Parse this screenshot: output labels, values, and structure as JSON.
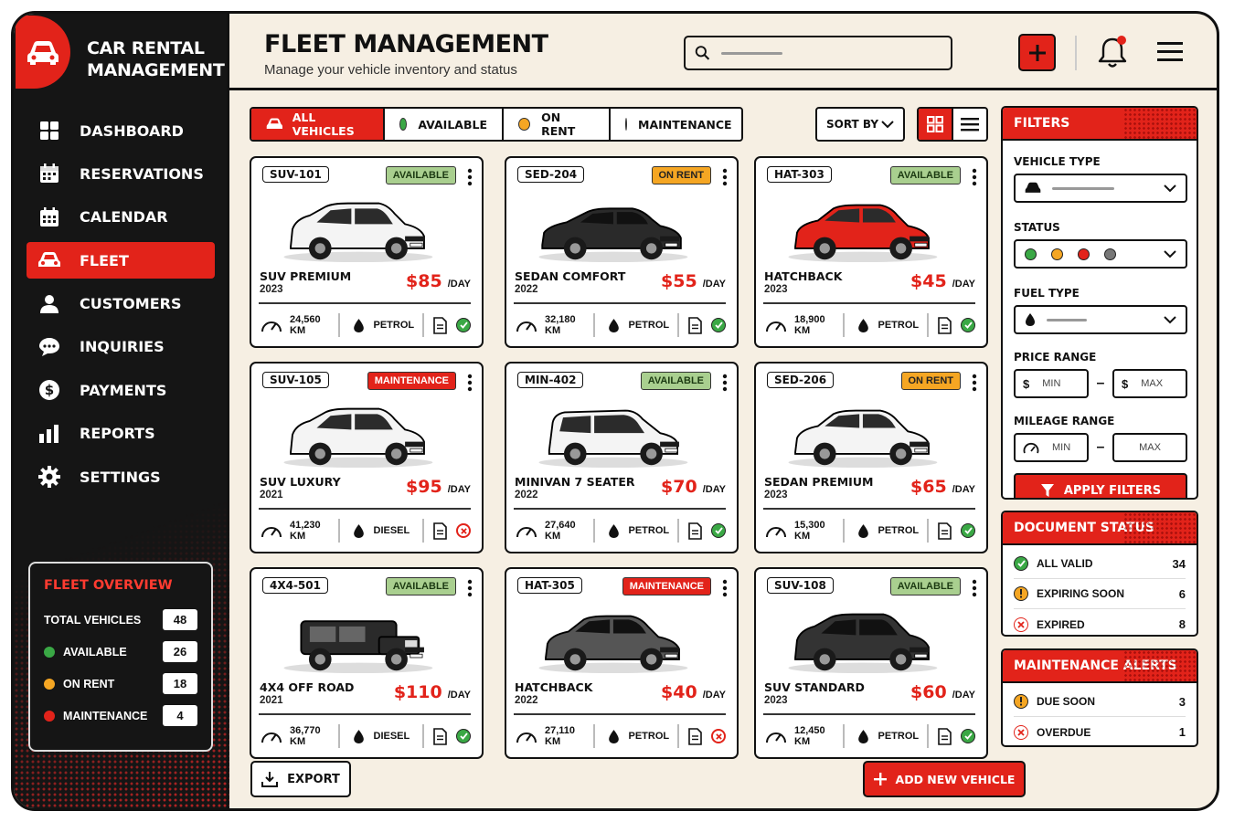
{
  "app": {
    "title_line1": "CAR RENTAL",
    "title_line2": "MANAGEMENT"
  },
  "nav": {
    "items": [
      {
        "label": "DASHBOARD",
        "icon": "dashboard-grid-icon"
      },
      {
        "label": "RESERVATIONS",
        "icon": "calendar-icon"
      },
      {
        "label": "CALENDAR",
        "icon": "calendar-icon"
      },
      {
        "label": "FLEET",
        "icon": "car-icon",
        "active": true
      },
      {
        "label": "CUSTOMERS",
        "icon": "user-icon"
      },
      {
        "label": "INQUIRIES",
        "icon": "chat-bubble-icon"
      },
      {
        "label": "PAYMENTS",
        "icon": "dollar-icon"
      },
      {
        "label": "REPORTS",
        "icon": "bar-chart-icon"
      },
      {
        "label": "SETTINGS",
        "icon": "gear-icon"
      }
    ]
  },
  "overview": {
    "title": "FLEET OVERVIEW",
    "rows": [
      {
        "label": "TOTAL VEHICLES",
        "value": "48",
        "color": ""
      },
      {
        "label": "AVAILABLE",
        "value": "26",
        "color": "#3aa845"
      },
      {
        "label": "ON RENT",
        "value": "18",
        "color": "#f5a623"
      },
      {
        "label": "MAINTENANCE",
        "value": "4",
        "color": "#e2231a"
      }
    ]
  },
  "header": {
    "title": "FLEET MANAGEMENT",
    "subtitle": "Manage your vehicle inventory and status"
  },
  "search": {
    "placeholder": ""
  },
  "tabs": {
    "all": "ALL VEHICLES",
    "available": "AVAILABLE",
    "onrent": "ON RENT",
    "maintenance": "MAINTENANCE"
  },
  "sort": {
    "label": "SORT BY"
  },
  "colors": {
    "accent": "#e2231a",
    "available": "#3aa845",
    "onrent": "#f5a623",
    "maintenance": "#e2231a",
    "grey": "#777777"
  },
  "vehicles": [
    {
      "code": "SUV-101",
      "status": "AVAILABLE",
      "name": "SUV PREMIUM",
      "year": "2023",
      "price": "$85",
      "unit": "/DAY",
      "km": "24,560",
      "km_unit": "KM",
      "fuel": "PETROL",
      "doc_ok": true,
      "body_color": "#f4f4f4",
      "style": "suv"
    },
    {
      "code": "SED-204",
      "status": "ON RENT",
      "name": "SEDAN COMFORT",
      "year": "2022",
      "price": "$55",
      "unit": "/DAY",
      "km": "32,180",
      "km_unit": "KM",
      "fuel": "PETROL",
      "doc_ok": true,
      "body_color": "#2a2a2a",
      "style": "sedan"
    },
    {
      "code": "HAT-303",
      "status": "AVAILABLE",
      "name": "HATCHBACK",
      "year": "2023",
      "price": "$45",
      "unit": "/DAY",
      "km": "18,900",
      "km_unit": "KM",
      "fuel": "PETROL",
      "doc_ok": true,
      "body_color": "#e2231a",
      "style": "hatch"
    },
    {
      "code": "SUV-105",
      "status": "MAINTENANCE",
      "name": "SUV LUXURY",
      "year": "2021",
      "price": "$95",
      "unit": "/DAY",
      "km": "41,230",
      "km_unit": "KM",
      "fuel": "DIESEL",
      "doc_ok": false,
      "body_color": "#f4f4f4",
      "style": "suv"
    },
    {
      "code": "MIN-402",
      "status": "AVAILABLE",
      "name": "MINIVAN 7 SEATER",
      "year": "2022",
      "price": "$70",
      "unit": "/DAY",
      "km": "27,640",
      "km_unit": "KM",
      "fuel": "PETROL",
      "doc_ok": true,
      "body_color": "#f4f4f4",
      "style": "van"
    },
    {
      "code": "SED-206",
      "status": "ON RENT",
      "name": "SEDAN PREMIUM",
      "year": "2023",
      "price": "$65",
      "unit": "/DAY",
      "km": "15,300",
      "km_unit": "KM",
      "fuel": "PETROL",
      "doc_ok": true,
      "body_color": "#f4f4f4",
      "style": "hatch"
    },
    {
      "code": "4X4-501",
      "status": "AVAILABLE",
      "name": "4X4 OFF ROAD",
      "year": "2021",
      "price": "$110",
      "unit": "/DAY",
      "km": "36,770",
      "km_unit": "KM",
      "fuel": "DIESEL",
      "doc_ok": true,
      "body_color": "#2a2a2a",
      "style": "jeep"
    },
    {
      "code": "HAT-305",
      "status": "MAINTENANCE",
      "name": "HATCHBACK",
      "year": "2022",
      "price": "$40",
      "unit": "/DAY",
      "km": "27,110",
      "km_unit": "KM",
      "fuel": "PETROL",
      "doc_ok": false,
      "body_color": "#555555",
      "style": "hatch"
    },
    {
      "code": "SUV-108",
      "status": "AVAILABLE",
      "name": "SUV STANDARD",
      "year": "2023",
      "price": "$60",
      "unit": "/DAY",
      "km": "12,450",
      "km_unit": "KM",
      "fuel": "PETROL",
      "doc_ok": true,
      "body_color": "#333333",
      "style": "suv"
    }
  ],
  "buttons": {
    "export": "EXPORT",
    "add_new": "ADD NEW VEHICLE",
    "apply": "APPLY FILTERS"
  },
  "filters": {
    "title": "FILTERS",
    "vehicle_type": "VEHICLE TYPE",
    "status": "STATUS",
    "fuel_type": "FUEL TYPE",
    "price_range": "PRICE RANGE",
    "mileage_range": "MILEAGE RANGE",
    "min": "MIN",
    "max": "MAX",
    "dash": "–",
    "dollar": "$"
  },
  "documents": {
    "title": "DOCUMENT STATUS",
    "rows": [
      {
        "label": "ALL VALID",
        "value": "34",
        "kind": "ok"
      },
      {
        "label": "EXPIRING SOON",
        "value": "6",
        "kind": "warn"
      },
      {
        "label": "EXPIRED",
        "value": "8",
        "kind": "bad"
      }
    ]
  },
  "maintenance": {
    "title": "MAINTENANCE ALERTS",
    "rows": [
      {
        "label": "DUE SOON",
        "value": "3",
        "kind": "warn"
      },
      {
        "label": "OVERDUE",
        "value": "1",
        "kind": "bad"
      }
    ]
  }
}
